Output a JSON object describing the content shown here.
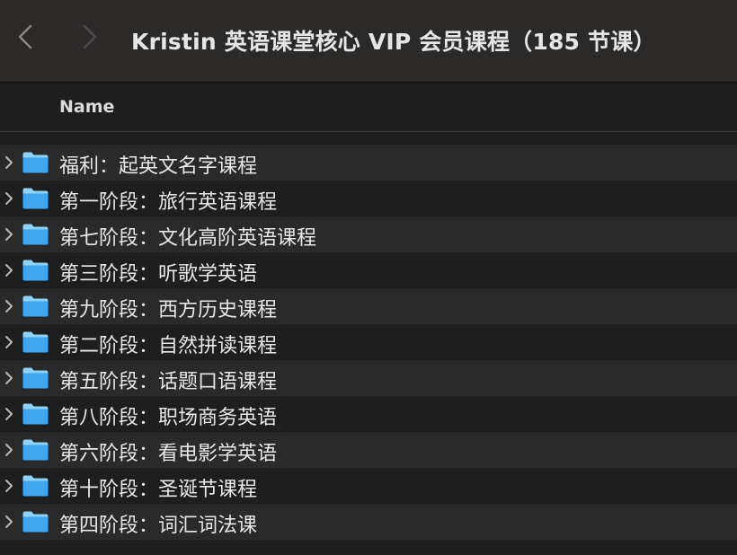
{
  "toolbar": {
    "title": "Kristin 英语课堂核心 VIP 会员课程（185 节课）",
    "back_icon": "chevron-left-icon",
    "forward_icon": "chevron-right-icon"
  },
  "columns": {
    "name": "Name"
  },
  "folders": [
    {
      "name": "福利：起英文名字课程"
    },
    {
      "name": "第一阶段：旅行英语课程"
    },
    {
      "name": "第七阶段：文化高阶英语课程"
    },
    {
      "name": "第三阶段：听歌学英语"
    },
    {
      "name": "第九阶段：西方历史课程"
    },
    {
      "name": "第二阶段：自然拼读课程"
    },
    {
      "name": "第五阶段：话题口语课程"
    },
    {
      "name": "第八阶段：职场商务英语"
    },
    {
      "name": "第六阶段：看电影学英语"
    },
    {
      "name": "第十阶段：圣诞节课程"
    },
    {
      "name": "第四阶段：词汇词法课"
    }
  ],
  "colors": {
    "folder_top": "#8fd3fb",
    "folder_body": "#3fa6ef",
    "row_alt": "#2b2a2a",
    "background": "#1e1e1e"
  }
}
